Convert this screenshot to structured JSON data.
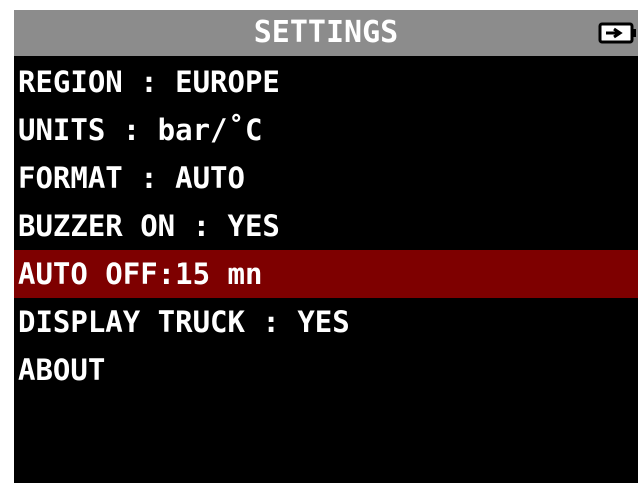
{
  "title": "SETTINGS",
  "icons": {
    "battery": "battery-icon"
  },
  "colors": {
    "title_bar": "#8c8c8c",
    "background": "#000000",
    "selected_row": "#7e0000",
    "text": "#ffffff"
  },
  "menu": {
    "selected_index": 4,
    "items": [
      {
        "label": "REGION : EUROPE"
      },
      {
        "label": "UNITS : bar/˚C"
      },
      {
        "label": "FORMAT : AUTO"
      },
      {
        "label": "BUZZER ON : YES"
      },
      {
        "label": "AUTO OFF:15 mn"
      },
      {
        "label": "DISPLAY TRUCK : YES"
      },
      {
        "label": "ABOUT"
      }
    ]
  }
}
